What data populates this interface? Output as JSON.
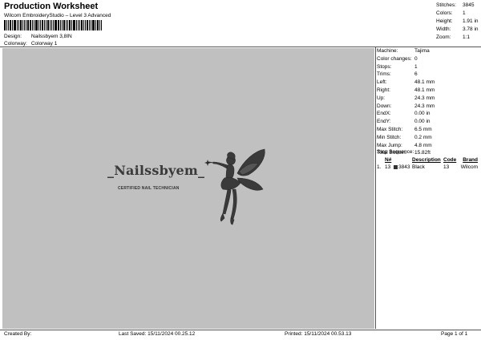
{
  "header": {
    "title": "Production Worksheet",
    "subtitle": "Wilcom EmbroideryStudio – Level 3 Advanced",
    "design_label": "Design:",
    "design_value": "Nailssbyem 3,8IN",
    "colorway_label": "Colorway:",
    "colorway_value": "Colorway 1"
  },
  "summary": [
    {
      "label": "Stitches:",
      "value": "3845"
    },
    {
      "label": "Colors:",
      "value": "1"
    },
    {
      "label": "Height:",
      "value": "1.91 in"
    },
    {
      "label": "Width:",
      "value": "3.78 in"
    },
    {
      "label": "Zoom:",
      "value": "1:1"
    }
  ],
  "params": [
    {
      "label": "Machine:",
      "value": "Tajima"
    },
    {
      "label": "Color changes:",
      "value": "0"
    },
    {
      "label": "Stops:",
      "value": "1"
    },
    {
      "label": "Trims:",
      "value": "6"
    },
    {
      "label": "Left:",
      "value": "48.1 mm"
    },
    {
      "label": "Right:",
      "value": "48.1 mm"
    },
    {
      "label": "Up:",
      "value": "24.3 mm"
    },
    {
      "label": "Down:",
      "value": "24.3 mm"
    },
    {
      "label": "EndX:",
      "value": "0.00 in"
    },
    {
      "label": "EndY:",
      "value": "0.00 in"
    },
    {
      "label": "Max Stitch:",
      "value": "6.5 mm"
    },
    {
      "label": "Min Stitch:",
      "value": "0.2 mm"
    },
    {
      "label": "Max Jump:",
      "value": "4.8 mm"
    },
    {
      "label": "Total Bobbin:",
      "value": "15.82ft"
    }
  ],
  "stop_sequence": {
    "title": "Stop Sequence:",
    "headers": [
      "",
      "N#",
      "",
      "Description",
      "Code",
      "Brand"
    ],
    "rows": [
      {
        "index": "1.",
        "n": "13",
        "stitches": "3843",
        "description": "Black",
        "code": "13",
        "brand": "Wilcom"
      }
    ],
    "swatch_color": "#333333"
  },
  "design": {
    "logo_text": "_Nailssbyem_",
    "logo_subtext": "CERTIFIED NAIL TECHNICIAN",
    "fairy_icon": "fairy-icon",
    "thread_color": "#3a3a3a",
    "canvas_color": "#c0c0c0"
  },
  "footer": {
    "created_by": "Created By:",
    "last_saved": "Last Saved: 15/11/2024 00.25.12",
    "printed": "Printed: 15/11/2024 00.53.13",
    "page": "Page 1 of 1"
  }
}
